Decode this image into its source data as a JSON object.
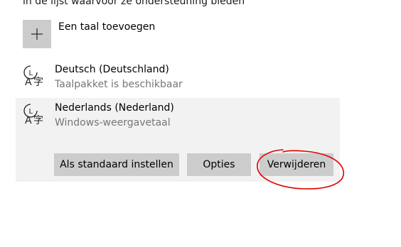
{
  "intro": {
    "text": "in de lijst waarvoor ze ondersteuning bieden"
  },
  "add_language": {
    "label": "Een taal toevoegen",
    "icon": "plus-icon"
  },
  "languages": [
    {
      "name": "Deutsch (Deutschland)",
      "status": "Taalpakket is beschikbaar",
      "icon": "language-icon"
    },
    {
      "name": "Nederlands (Nederland)",
      "status": "Windows-weergavetaal",
      "icon": "language-icon",
      "selected": true,
      "actions": {
        "set_default": "Als standaard instellen",
        "options": "Opties",
        "remove": "Verwijderen"
      }
    }
  ],
  "colors": {
    "button_bg": "#cccccc",
    "selected_bg": "#f2f2f2",
    "secondary_text": "#767676",
    "annotation": "#e00000"
  }
}
